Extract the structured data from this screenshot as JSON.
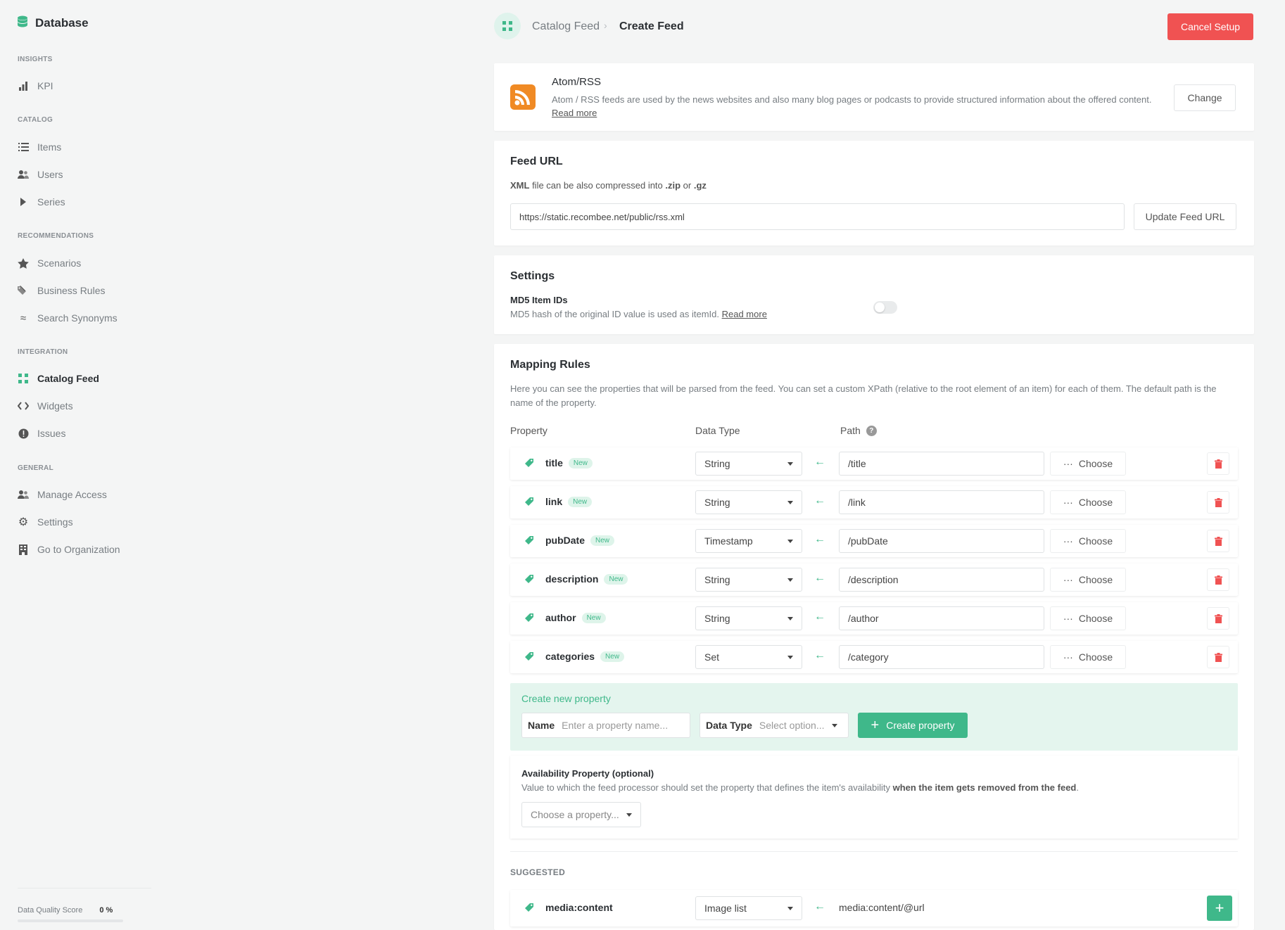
{
  "sidebar": {
    "brand": "Database",
    "sections": [
      {
        "title": "INSIGHTS",
        "items": [
          {
            "label": "KPI",
            "icon": "bar-chart-icon"
          }
        ]
      },
      {
        "title": "CATALOG",
        "items": [
          {
            "label": "Items",
            "icon": "list-icon"
          },
          {
            "label": "Users",
            "icon": "users-icon"
          },
          {
            "label": "Series",
            "icon": "play-icon"
          }
        ]
      },
      {
        "title": "RECOMMENDATIONS",
        "items": [
          {
            "label": "Scenarios",
            "icon": "star-icon"
          },
          {
            "label": "Business Rules",
            "icon": "tags-icon"
          },
          {
            "label": "Search Synonyms",
            "icon": "approx-icon"
          }
        ]
      },
      {
        "title": "INTEGRATION",
        "items": [
          {
            "label": "Catalog Feed",
            "icon": "grid-icon",
            "active": true
          },
          {
            "label": "Widgets",
            "icon": "code-icon"
          },
          {
            "label": "Issues",
            "icon": "alert-icon"
          }
        ]
      },
      {
        "title": "GENERAL",
        "items": [
          {
            "label": "Manage Access",
            "icon": "users-icon"
          },
          {
            "label": "Settings",
            "icon": "gear-icon"
          },
          {
            "label": "Go to Organization",
            "icon": "building-icon"
          }
        ]
      }
    ],
    "data_quality": {
      "label": "Data Quality Score",
      "value": "0 %",
      "progress": 0
    }
  },
  "header": {
    "crumb_parent": "Catalog Feed",
    "crumb_current": "Create Feed",
    "cancel_label": "Cancel Setup"
  },
  "feed_type": {
    "title": "Atom/RSS",
    "description": "Atom / RSS feeds are used by the news websites and also many blog pages or podcasts to provide structured information about the offered content.",
    "read_more": "Read more",
    "change_label": "Change"
  },
  "feed_url": {
    "title": "Feed URL",
    "hint_bold1": "XML",
    "hint_mid1": " file can be also compressed into ",
    "hint_bold2": ".zip",
    "hint_mid2": " or ",
    "hint_bold3": ".gz",
    "value": "https://static.recombee.net/public/rss.xml",
    "update_label": "Update Feed URL"
  },
  "settings": {
    "title": "Settings",
    "md5_label": "MD5 Item IDs",
    "md5_desc": "MD5 hash of the original ID value is used as itemId.",
    "read_more": "Read more",
    "md5_enabled": false
  },
  "mapping": {
    "title": "Mapping Rules",
    "description": "Here you can see the properties that will be parsed from the feed. You can set a custom XPath (relative to the root element of an item) for each of them. The default path is the name of the property.",
    "col_property": "Property",
    "col_type": "Data Type",
    "col_path": "Path",
    "choose_label": "Choose",
    "new_badge": "New",
    "rows": [
      {
        "name": "title",
        "type": "String",
        "path": "/title"
      },
      {
        "name": "link",
        "type": "String",
        "path": "/link"
      },
      {
        "name": "pubDate",
        "type": "Timestamp",
        "path": "/pubDate"
      },
      {
        "name": "description",
        "type": "String",
        "path": "/description"
      },
      {
        "name": "author",
        "type": "String",
        "path": "/author"
      },
      {
        "name": "categories",
        "type": "Set",
        "path": "/category"
      }
    ],
    "create": {
      "title": "Create new property",
      "name_label": "Name",
      "name_placeholder": "Enter a property name...",
      "type_label": "Data Type",
      "type_placeholder": "Select option...",
      "button": "Create property"
    },
    "availability": {
      "title": "Availability Property (optional)",
      "desc_start": "Value to which the feed processor should set the property that defines the item's availability ",
      "desc_bold": "when the item gets removed from the feed",
      "desc_end": ".",
      "placeholder": "Choose a property..."
    },
    "suggested": {
      "title": "SUGGESTED",
      "rows": [
        {
          "name": "media:content",
          "type": "Image list",
          "path": "media:content/@url"
        }
      ]
    }
  },
  "colors": {
    "accent": "#3fb88a",
    "danger": "#f05252",
    "rss": "#f08a24"
  }
}
